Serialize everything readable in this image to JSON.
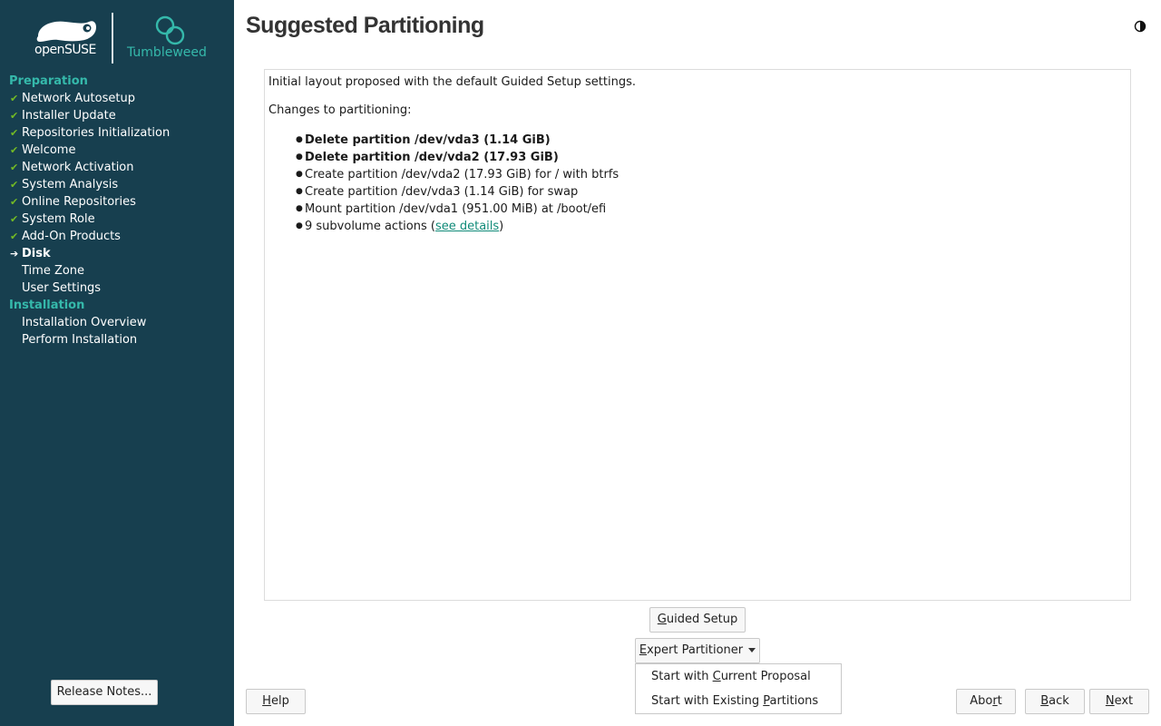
{
  "sidebar": {
    "logo_brand": "openSUSE",
    "logo_product": "Tumbleweed",
    "sections": [
      {
        "title": "Preparation",
        "steps": [
          {
            "label": "Network Autosetup",
            "state": "done"
          },
          {
            "label": "Installer Update",
            "state": "done"
          },
          {
            "label": "Repositories Initialization",
            "state": "done"
          },
          {
            "label": "Welcome",
            "state": "done"
          },
          {
            "label": "Network Activation",
            "state": "done"
          },
          {
            "label": "System Analysis",
            "state": "done"
          },
          {
            "label": "Online Repositories",
            "state": "done"
          },
          {
            "label": "System Role",
            "state": "done"
          },
          {
            "label": "Add-On Products",
            "state": "done"
          },
          {
            "label": "Disk",
            "state": "current"
          },
          {
            "label": "Time Zone",
            "state": "pending"
          },
          {
            "label": "User Settings",
            "state": "pending"
          }
        ]
      },
      {
        "title": "Installation",
        "steps": [
          {
            "label": "Installation Overview",
            "state": "pending"
          },
          {
            "label": "Perform Installation",
            "state": "pending"
          }
        ]
      }
    ],
    "release_notes_label": "Release Notes..."
  },
  "main": {
    "title": "Suggested Partitioning",
    "intro": "Initial layout proposed with the default Guided Setup settings.",
    "changes_heading": "Changes to partitioning:",
    "actions": [
      {
        "text": "Delete partition /dev/vda3 (1.14 GiB)",
        "bold": true
      },
      {
        "text": "Delete partition /dev/vda2 (17.93 GiB)",
        "bold": true
      },
      {
        "text": "Create partition /dev/vda2 (17.93 GiB) for / with btrfs",
        "bold": false
      },
      {
        "text": "Create partition /dev/vda3 (1.14 GiB) for swap",
        "bold": false
      },
      {
        "text": "Mount partition /dev/vda1 (951.00 MiB) at /boot/efi",
        "bold": false
      }
    ],
    "subvolume_prefix": "9 subvolume actions (",
    "subvolume_link": "see details",
    "subvolume_suffix": ")"
  },
  "buttons": {
    "guided_setup_accel": "G",
    "guided_setup_rest": "uided Setup",
    "expert_accel": "E",
    "expert_rest": "xpert Partitioner",
    "help_accel": "H",
    "help_rest": "elp",
    "abort_pre": "Abo",
    "abort_accel": "r",
    "abort_post": "t",
    "back_accel": "B",
    "back_rest": "ack",
    "next_accel": "N",
    "next_rest": "ext"
  },
  "expert_menu": {
    "item1_pre": "Start with ",
    "item1_accel": "C",
    "item1_post": "urrent Proposal",
    "item2_pre": "Start with Existing ",
    "item2_accel": "P",
    "item2_post": "artitions"
  },
  "colors": {
    "sidebar_bg": "#173f4f",
    "accent": "#35b9ab",
    "check": "#73ba25",
    "link": "#0f8a78"
  },
  "icons": {
    "theme": "half-moon-icon",
    "done": "check-icon",
    "current": "arrow-right-icon"
  }
}
